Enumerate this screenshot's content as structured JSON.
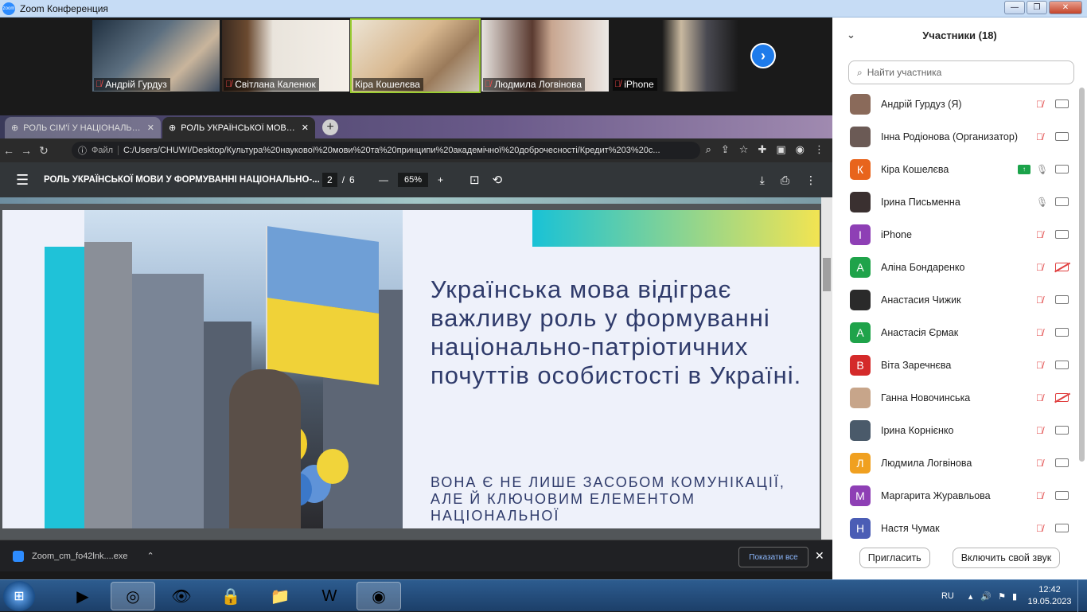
{
  "window": {
    "title": "Zoom Конференция"
  },
  "gallery": {
    "tiles": [
      {
        "name": "Андрій Гурдуз"
      },
      {
        "name": "Світлана Каленюк"
      },
      {
        "name": "Кіра Кошелєва"
      },
      {
        "name": "Людмила Логвінова"
      },
      {
        "name": "iPhone"
      }
    ]
  },
  "browser": {
    "tabs": [
      {
        "label": "РОЛЬ СІМ'Ї У НАЦІОНАЛЬНО-П"
      },
      {
        "label": "РОЛЬ УКРАЇНСЬКОЇ МОВИ У Ф..."
      }
    ],
    "address_chip": "Файл",
    "url": "C:/Users/CHUWI/Desktop/Культура%20наукової%20мови%20та%20принципи%20академічної%20доброчесності/Кредит%203%20c...",
    "pdf": {
      "title": "РОЛЬ УКРАЇНСЬКОЇ МОВИ У ФОРМУВАННІ НАЦІОНАЛЬНО-...",
      "page": "2",
      "total": "6",
      "zoom": "65%",
      "slide_headline": "Українська мова відіграє важливу роль у формуванні національно-патріотичних почуттів особистості в Україні.",
      "slide_sub": "ВОНА Є НЕ ЛИШЕ ЗАСОБОМ КОМУНІКАЦІЇ, АЛЕ Й КЛЮЧОВИМ ЕЛЕМЕНТОМ НАЦІОНАЛЬНОЇ"
    },
    "download": {
      "file": "Zoom_cm_fo42lnk....exe",
      "show_all": "Показати все"
    }
  },
  "panel": {
    "title": "Участники (18)",
    "search_placeholder": "Найти участника",
    "participants": [
      {
        "name": "Андрій Гурдуз (Я)",
        "initial": "",
        "color": "#8a6a5a",
        "mic": "off",
        "cam": "on",
        "share": false
      },
      {
        "name": "Інна Родіонова (Организатор)",
        "initial": "",
        "color": "#6b5a55",
        "mic": "off",
        "cam": "on",
        "share": false
      },
      {
        "name": "Кіра Кошелєва",
        "initial": "К",
        "color": "#e8641c",
        "mic": "on",
        "cam": "on",
        "share": true
      },
      {
        "name": "Ірина Письменна",
        "initial": "",
        "color": "#3a3030",
        "mic": "on",
        "cam": "on",
        "share": false
      },
      {
        "name": "iPhone",
        "initial": "I",
        "color": "#8e3fb5",
        "mic": "off",
        "cam": "on",
        "share": false
      },
      {
        "name": "Аліна Бондаренко",
        "initial": "А",
        "color": "#1fa34a",
        "mic": "off",
        "cam": "off",
        "share": false
      },
      {
        "name": "Анастасия Чижик",
        "initial": "",
        "color": "#2a2a2a",
        "mic": "off",
        "cam": "on",
        "share": false
      },
      {
        "name": "Анастасія Єрмак",
        "initial": "А",
        "color": "#1fa34a",
        "mic": "off",
        "cam": "on",
        "share": false
      },
      {
        "name": "Віта Заречнєва",
        "initial": "В",
        "color": "#d42a2a",
        "mic": "off",
        "cam": "on",
        "share": false
      },
      {
        "name": "Ганна Новочинська",
        "initial": "",
        "color": "#c7a58a",
        "mic": "off",
        "cam": "off",
        "share": false
      },
      {
        "name": "Ірина Корнієнко",
        "initial": "",
        "color": "#4a5a6a",
        "mic": "off",
        "cam": "on",
        "share": false
      },
      {
        "name": "Людмила Логвінова",
        "initial": "Л",
        "color": "#f0a020",
        "mic": "off",
        "cam": "on",
        "share": false
      },
      {
        "name": "Маргарита Журавльова",
        "initial": "М",
        "color": "#8e3fb5",
        "mic": "off",
        "cam": "on",
        "share": false
      },
      {
        "name": "Настя Чумак",
        "initial": "Н",
        "color": "#4b5db5",
        "mic": "off",
        "cam": "on",
        "share": false
      }
    ],
    "invite": "Пригласить",
    "unmute": "Включить свой звук"
  },
  "taskbar": {
    "lang": "RU",
    "time": "12:42",
    "date": "19.05.2023"
  }
}
